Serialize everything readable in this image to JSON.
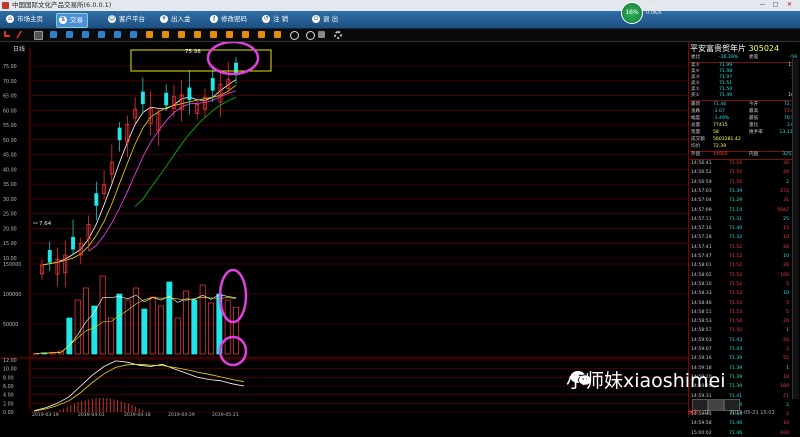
{
  "app": {
    "title": "中国国际文化产品交易所(6.0.0.1)"
  },
  "window_controls": [
    "—",
    "□",
    "✕"
  ],
  "nav": [
    {
      "label": "市场主页"
    },
    {
      "label": "交易"
    },
    {
      "label": "客户平台"
    },
    {
      "label": "出入金"
    },
    {
      "label": "修改密码"
    },
    {
      "label": "注 销"
    },
    {
      "label": "退 出"
    }
  ],
  "network": {
    "percent": "16%",
    "up": "0.0K/s",
    "down": "0.0K/s"
  },
  "chart": {
    "period_label": "日线",
    "y_axis_prices": [
      "75.00",
      "70.00",
      "65.00",
      "60.00",
      "55.00",
      "50.00",
      "45.00",
      "40.00",
      "35.00",
      "30.00",
      "25.00",
      "20.00",
      "15.00",
      "10.00"
    ],
    "y_axis_volume": [
      "150000",
      "100000",
      "50000"
    ],
    "y_axis_indicator": [
      "12.00",
      "10.00",
      "8.00",
      "6.00",
      "4.00",
      "2.00",
      "0.00"
    ],
    "low_marker": "7.64",
    "high_marker": "75.98",
    "x_dates": [
      "2019-03-19",
      "2019-04-01",
      "2019-04-18",
      "2019-04-29",
      "2019-05-21"
    ]
  },
  "chart_data": [
    {
      "type": "candlestick",
      "title": "",
      "ylim": [
        8,
        78
      ],
      "points": [
        {
          "x": "2019-03-19",
          "close": 7.64
        },
        {
          "x": "2019-03-26",
          "close": 10
        },
        {
          "x": "2019-04-01",
          "close": 15
        },
        {
          "x": "2019-04-08",
          "close": 31
        },
        {
          "x": "2019-04-15",
          "close": 50
        },
        {
          "x": "2019-04-18",
          "close": 63
        },
        {
          "x": "2019-04-24",
          "close": 59
        },
        {
          "x": "2019-04-29",
          "close": 66
        },
        {
          "x": "2019-05-08",
          "close": 62
        },
        {
          "x": "2019-05-15",
          "close": 68
        },
        {
          "x": "2019-05-21",
          "close": 72
        }
      ],
      "annotations": [
        "75.98",
        "7.64"
      ]
    },
    {
      "type": "bar",
      "title": "",
      "ylim": [
        0,
        150000
      ],
      "values": [
        1000,
        2000,
        3000,
        5000,
        60000,
        90000,
        110000,
        80000,
        130000,
        60000,
        100000,
        90000,
        110000,
        75000,
        95000,
        80000,
        120000,
        60000,
        105000,
        90000,
        115000,
        85000,
        100000,
        90000,
        78000
      ]
    },
    {
      "type": "line",
      "title": "",
      "ylim": [
        0,
        12
      ],
      "series": [
        {
          "values": [
            0.3,
            1.0,
            2.0,
            3.5,
            6.0,
            8.5,
            10.5,
            11.8,
            11.5,
            10.8,
            10.5,
            11.0,
            10.0,
            9.0,
            8.0,
            7.5,
            7.2,
            6.5,
            6.0
          ]
        },
        {
          "values": [
            0.2,
            0.7,
            1.5,
            2.6,
            4.5,
            6.8,
            8.8,
            10.3,
            10.9,
            11.0,
            10.8,
            10.7,
            10.3,
            9.8,
            9.2,
            8.7,
            8.1,
            7.5,
            7.0
          ]
        }
      ]
    }
  ],
  "quote": {
    "name": "平安富贵贺年片",
    "code": "305024",
    "ask_label": "委比",
    "ask_value": "-16.19%",
    "diff_label": "委差",
    "diff_value": "-59",
    "rows": [
      {
        "l": "卖⑤",
        "p": "71.99",
        "v": "114"
      },
      {
        "l": "卖④",
        "p": "71.98",
        "v": "11"
      },
      {
        "l": "卖③",
        "p": "71.97",
        "v": "35"
      },
      {
        "l": "卖②",
        "p": "71.51",
        "v": "3"
      },
      {
        "l": "卖①",
        "p": "71.50",
        "v": "6"
      },
      {
        "l": "买①",
        "p": "71.49",
        "v": "100"
      }
    ],
    "stats": [
      {
        "l": "最新",
        "v": "71.46"
      },
      {
        "l": "涨跌",
        "v": "-1.07"
      },
      {
        "l": "幅度",
        "v": "-1.49%"
      },
      {
        "l": "总量",
        "v": "77415"
      },
      {
        "l": "现量",
        "v": "58"
      },
      {
        "l": "成交额",
        "v": "5603281.42"
      },
      {
        "l": "均价",
        "v": "72.39"
      },
      {
        "l": "外盘",
        "v": "44900"
      }
    ],
    "stats_right": [
      {
        "l": "今开",
        "v": "72.16"
      },
      {
        "l": "最高",
        "v": "73.88"
      },
      {
        "l": "最低",
        "v": "70.59"
      },
      {
        "l": "量比",
        "v": "1.06"
      },
      {
        "l": "换手率",
        "v": "13.11%"
      },
      {
        "l": "内盘",
        "v": "32515"
      }
    ],
    "ticks": [
      {
        "t": "14:56:41",
        "p": "71.55",
        "v": "30"
      },
      {
        "t": "14:56:52",
        "p": "71.50",
        "v": "20"
      },
      {
        "t": "14:56:59",
        "p": "71.50",
        "v": "2"
      },
      {
        "t": "14:57:03",
        "p": "71.39",
        "v": "272"
      },
      {
        "t": "14:57:04",
        "p": "71.29",
        "v": "31"
      },
      {
        "t": "14:57:09",
        "p": "71.14",
        "v": "5047"
      },
      {
        "t": "14:57:11",
        "p": "71.31",
        "v": "25"
      },
      {
        "t": "14:57:16",
        "p": "71.40",
        "v": "15"
      },
      {
        "t": "14:57:28",
        "p": "71.32",
        "v": "10"
      },
      {
        "t": "14:57:41",
        "p": "71.52",
        "v": "20"
      },
      {
        "t": "14:57:47",
        "p": "71.52",
        "v": "10"
      },
      {
        "t": "14:58:01",
        "p": "71.52",
        "v": "20"
      },
      {
        "t": "14:58:02",
        "p": "71.52",
        "v": "100"
      },
      {
        "t": "14:58:10",
        "p": "71.52",
        "v": "5"
      },
      {
        "t": "14:58:33",
        "p": "71.53",
        "v": "10"
      },
      {
        "t": "14:58:46",
        "p": "71.53",
        "v": "5"
      },
      {
        "t": "14:58:51",
        "p": "71.53",
        "v": "5"
      },
      {
        "t": "14:58:53",
        "p": "71.50",
        "v": "20"
      },
      {
        "t": "14:58:57",
        "p": "71.50",
        "v": "1"
      },
      {
        "t": "14:59:03",
        "p": "71.43",
        "v": "50"
      },
      {
        "t": "14:59:07",
        "p": "71.43",
        "v": "2"
      },
      {
        "t": "14:59:16",
        "p": "71.39",
        "v": "55"
      },
      {
        "t": "14:59:18",
        "p": "71.39",
        "v": "1"
      },
      {
        "t": "14:59:20",
        "p": "71.39",
        "v": "10"
      },
      {
        "t": "14:59:26",
        "p": "71.39",
        "v": "100"
      },
      {
        "t": "14:59:31",
        "p": "71.41",
        "v": "21"
      },
      {
        "t": "14:59:36",
        "p": "71.44",
        "v": "2"
      },
      {
        "t": "14:59:43",
        "p": "71.44",
        "v": "2"
      },
      {
        "t": "14:59:58",
        "p": "71.46",
        "v": "10"
      },
      {
        "t": "15:00:02",
        "p": "71.46",
        "v": "100"
      }
    ],
    "footer_label": "休市",
    "footer_count": "15",
    "footer_time": "2019-05-21 15:03"
  },
  "watermark": "小师妹xiaoshimei",
  "colors": {
    "up": "#ff3b3b",
    "down": "#22e5e5",
    "highlight_circle": "#e040e0",
    "highlight_box": "#e8e800",
    "ma5": "#ffffff",
    "ma10": "#e8e000",
    "ma20": "#ff40ff",
    "ma60": "#00c800"
  }
}
